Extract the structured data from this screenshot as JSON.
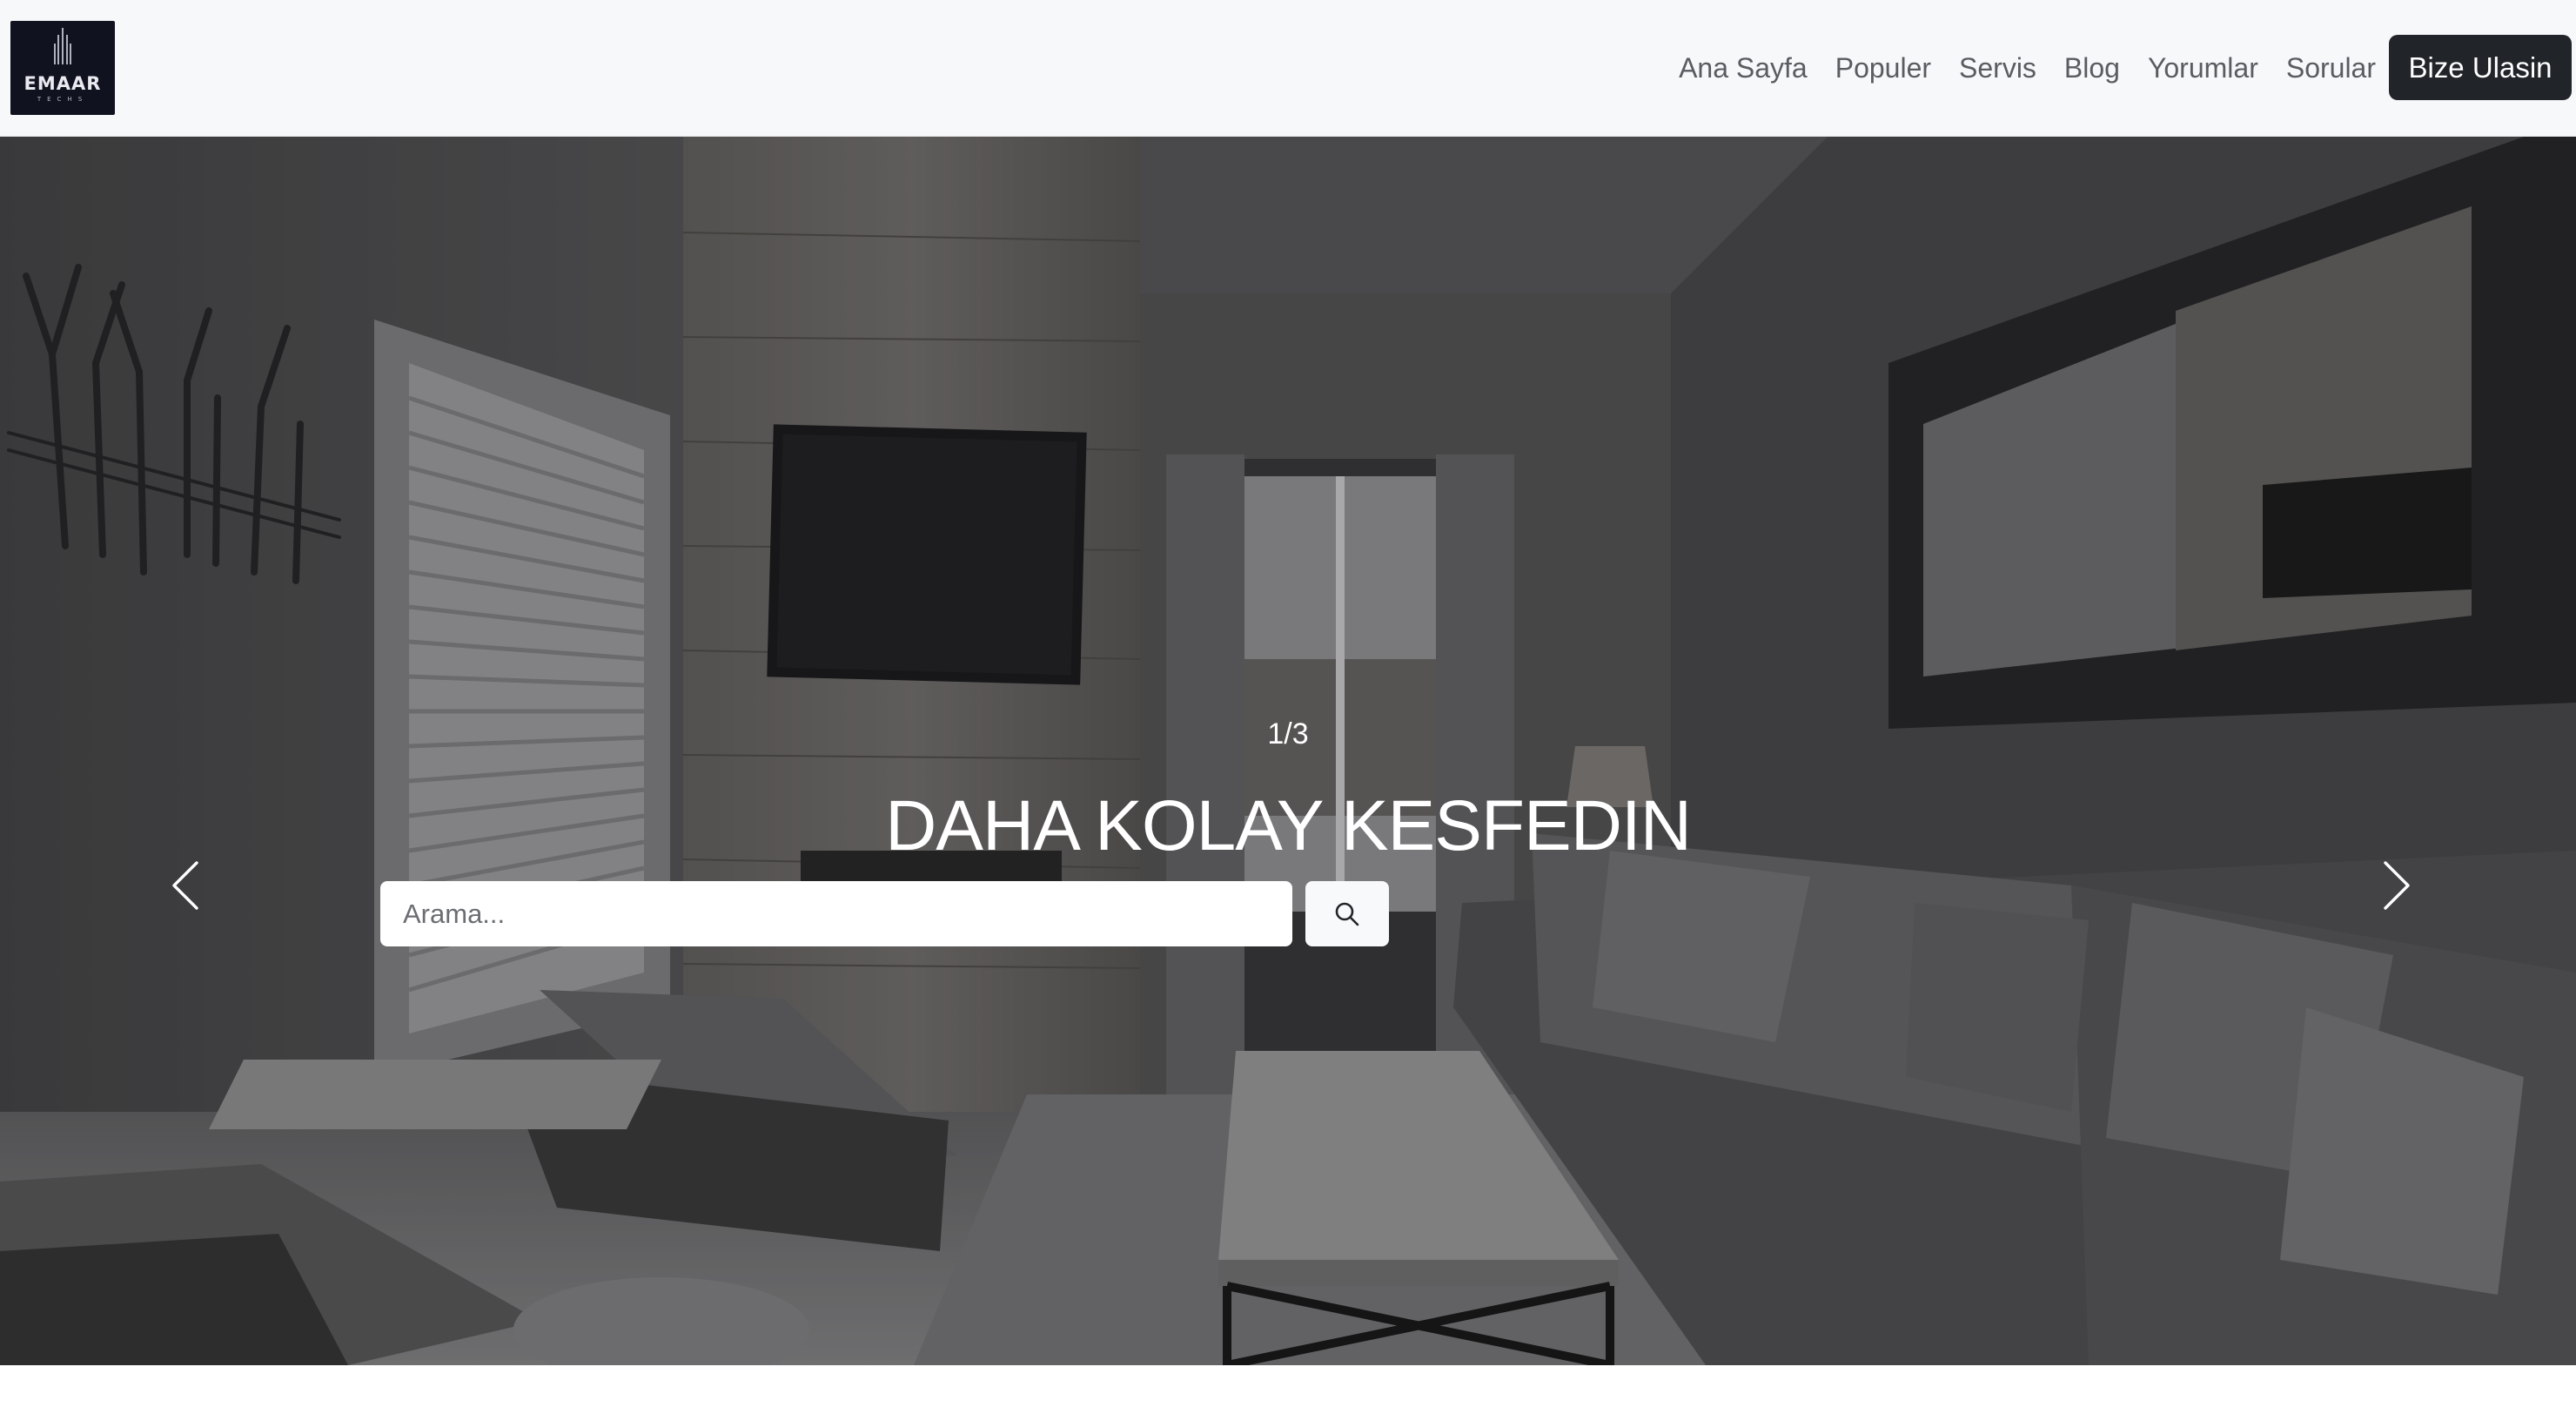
{
  "brand": {
    "logo_text": "EMAAR",
    "logo_subtext": "TECHS"
  },
  "nav": {
    "links": [
      "Ana Sayfa",
      "Populer",
      "Servis",
      "Blog",
      "Yorumlar",
      "Sorular"
    ],
    "cta_label": "Bize Ulasin"
  },
  "hero": {
    "slide_counter": "1/3",
    "title": "DAHA KOLAY KESFEDIN",
    "search_placeholder": "Arama...",
    "active_slide": 1,
    "slide_count": 3
  },
  "colors": {
    "navbar_bg": "#f7f8fa",
    "cta_bg": "#212529",
    "logo_bg": "#11121f"
  },
  "icons": {
    "search": "search-icon",
    "prev": "chevron-left-icon",
    "next": "chevron-right-icon"
  }
}
